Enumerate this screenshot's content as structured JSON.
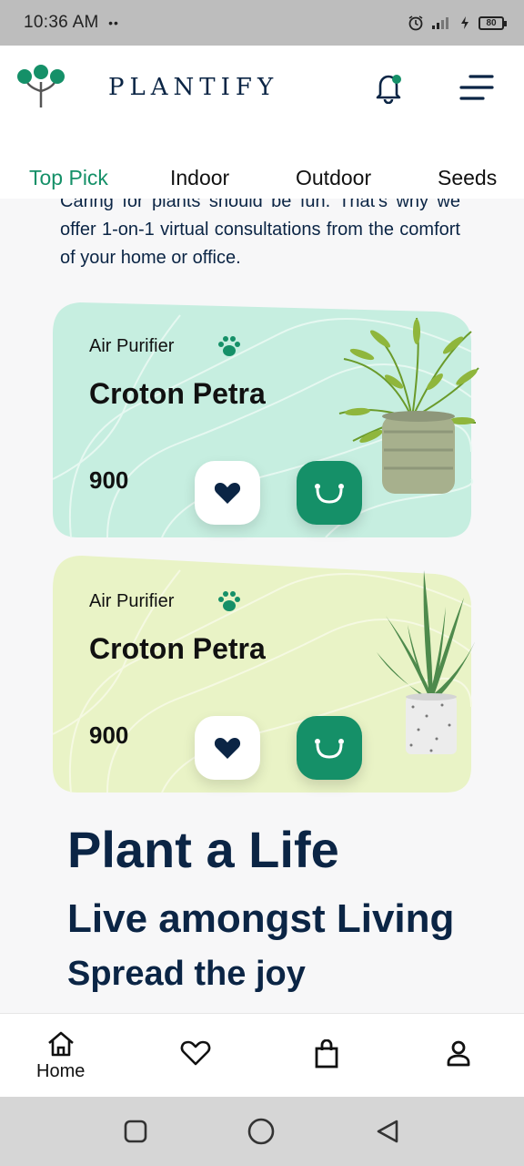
{
  "status_bar": {
    "time": "10:36 AM",
    "dots": "••",
    "battery": "80"
  },
  "header": {
    "brand": "PLANTIFY",
    "icons": [
      "plant-logo-icon",
      "bell-icon",
      "menu-icon"
    ]
  },
  "tabs": [
    {
      "label": "Top Pick",
      "active": true
    },
    {
      "label": "Indoor",
      "active": false
    },
    {
      "label": "Outdoor",
      "active": false
    },
    {
      "label": "Seeds",
      "active": false
    }
  ],
  "intro": {
    "text": "Caring for plants should be fun. That's why we offer 1-on-1 virtual consultations from the comfort of your home or office."
  },
  "cards": [
    {
      "category": "Air Purifier",
      "name": "Croton Petra",
      "price": "900",
      "color": "#c6eee0"
    },
    {
      "category": "Air Purifier",
      "name": "Croton Petra",
      "price": "900",
      "color": "#e9f3c6"
    }
  ],
  "headlines": {
    "line1": "Plant a Life",
    "line2": "Live amongst Living",
    "line3": "Spread the joy"
  },
  "bottom_nav": {
    "home_label": "Home",
    "icons": [
      "home-icon",
      "heart-icon",
      "bag-icon",
      "profile-icon"
    ]
  },
  "colors": {
    "accent": "#159068",
    "navy": "#0b2545"
  }
}
